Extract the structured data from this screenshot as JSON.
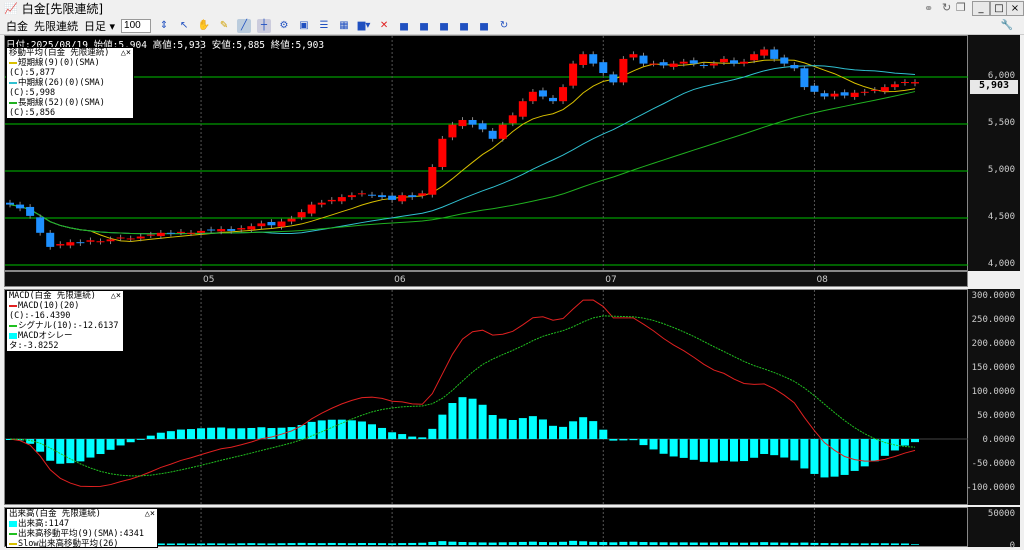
{
  "window": {
    "title": "白金[先限連続]",
    "icon": "chart-icon"
  },
  "toolbar": {
    "commodity": "白金",
    "contract": "先限連続",
    "period": "日足",
    "count": "100"
  },
  "info": {
    "text": "日付:2025/08/19 始値:5,904 高値:5,933 安値:5,885 終値:5,903"
  },
  "ma_legend": {
    "title": "移動平均(白金 先限連続)",
    "items": [
      {
        "label": "短期線(9)(0)(SMA)(C):5,877",
        "color": "#d8c000"
      },
      {
        "label": "中期線(26)(0)(SMA)(C):5,998",
        "color": "#30c0d0"
      },
      {
        "label": "長期線(52)(0)(SMA)(C):5,856",
        "color": "#20b020"
      }
    ]
  },
  "macd_legend": {
    "title": "MACD(白金 先限連続)",
    "items": [
      {
        "label": "MACD(10)(20)(C):-16.4390",
        "color": "#e02020"
      },
      {
        "label": "シグナル(10):-12.6137",
        "color": "#20c020"
      },
      {
        "label": "MACDオシレータ:-3.8252",
        "color": "#00ffff"
      }
    ]
  },
  "vol_legend": {
    "title": "出来高(白金 先限連続)",
    "items": [
      {
        "label": "出来高:1147",
        "color": "#00ffff"
      },
      {
        "label": "出来高移動平均(9)(SMA):4341",
        "color": "#20c020"
      },
      {
        "label": "Slow出来高移動平均(26)(SMA):6617",
        "color": "#d8c000"
      }
    ]
  },
  "current_price": "5,903",
  "colors": {
    "up": "#ff0000",
    "down": "#1e90ff",
    "grid": "#00c000"
  },
  "chart_data": [
    {
      "type": "candlestick",
      "yticks": [
        "6,000",
        "5,500",
        "5,000",
        "4,500",
        "4,000"
      ],
      "ylim": [
        3950,
        6400
      ],
      "xticks": [
        {
          "label": "05",
          "index": 19
        },
        {
          "label": "06",
          "index": 38
        },
        {
          "label": "07",
          "index": 59
        },
        {
          "label": "08",
          "index": 80
        }
      ],
      "close": [
        4600,
        4560,
        4480,
        4300,
        4150,
        4180,
        4200,
        4190,
        4220,
        4210,
        4230,
        4250,
        4240,
        4260,
        4280,
        4300,
        4290,
        4310,
        4300,
        4320,
        4330,
        4340,
        4320,
        4350,
        4370,
        4400,
        4380,
        4420,
        4450,
        4520,
        4600,
        4620,
        4650,
        4680,
        4700,
        4720,
        4700,
        4680,
        4650,
        4700,
        4680,
        4720,
        5000,
        5300,
        5450,
        5500,
        5450,
        5400,
        5300,
        5450,
        5550,
        5700,
        5800,
        5750,
        5700,
        5850,
        6100,
        6200,
        6100,
        6000,
        5900,
        6150,
        6200,
        6100,
        6100,
        6080,
        6100,
        6120,
        6100,
        6080,
        6100,
        6150,
        6100,
        6120,
        6200,
        6250,
        6150,
        6100,
        6050,
        5850,
        5800,
        5750,
        5780,
        5760,
        5790,
        5800,
        5820,
        5850,
        5880,
        5904,
        5903
      ]
    },
    {
      "type": "macd",
      "yticks": [
        "300.0000",
        "250.0000",
        "200.0000",
        "150.0000",
        "100.0000",
        "50.0000",
        "0.0000",
        "-50.0000",
        "-100.0000"
      ],
      "ylim": [
        -130,
        300
      ]
    },
    {
      "type": "bar",
      "yticks": [
        "50000",
        "0"
      ],
      "ylim": [
        0,
        50000
      ],
      "volume": [
        3000,
        2500,
        2800,
        3500,
        3200,
        2600,
        2400,
        2300,
        2500,
        2600,
        2200,
        2400,
        2300,
        2500,
        2600,
        2400,
        2300,
        2500,
        2200,
        2400,
        2600,
        2500,
        2300,
        2700,
        2900,
        2600,
        2500,
        2800,
        3000,
        3300,
        3100,
        2900,
        3200,
        3000,
        2800,
        3100,
        3000,
        2900,
        2700,
        3000,
        3200,
        3500,
        4800,
        6000,
        5200,
        4700,
        4300,
        4000,
        3800,
        4200,
        4400,
        4800,
        5200,
        4600,
        4300,
        5000,
        6500,
        5800,
        5000,
        4600,
        4200,
        4900,
        5100,
        4600,
        4300,
        4200,
        4000,
        4100,
        3900,
        3800,
        3900,
        4200,
        3800,
        3600,
        4000,
        4400,
        3900,
        3600,
        3400,
        3800,
        3300,
        3000,
        2900,
        2800,
        2700,
        2600,
        2800,
        2700,
        2500,
        2400,
        1147
      ]
    }
  ]
}
